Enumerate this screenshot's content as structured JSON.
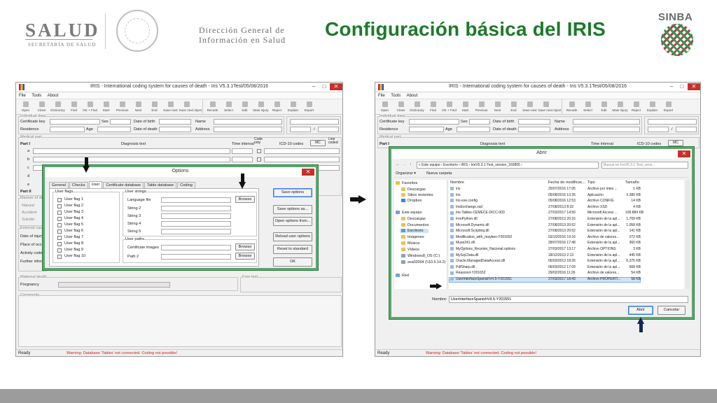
{
  "header": {
    "salud_word": "SALUD",
    "salud_sub": "SECRETARÍA DE SALUD",
    "dg_line1": "Dirección General de",
    "dg_line2": "Información en Salud",
    "slide_title": "Configuración básica del IRIS",
    "sinba": "SINBA"
  },
  "left_window": {
    "title": "IRIS - International coding system for causes of death - Iris V5.3.1Test/05/08/2016",
    "menu": [
      "File",
      "Tools",
      "About"
    ],
    "toolbar": [
      "Open",
      "Close",
      "Dictionary",
      "Find",
      "OK + Find",
      "Start",
      "Previous",
      "Next",
      "End",
      "Save next",
      "Save next reject",
      "Recode",
      "Select",
      "Edit",
      "Main injury",
      "Reject",
      "Explain",
      "Export"
    ],
    "groups": {
      "individual": "Individual data",
      "medical": "Medical part",
      "manner": "Manner of death",
      "external": "External cause",
      "maternal": "Maternal death",
      "freetext": "Free text",
      "comments": "Comments",
      "underlying": "Underlying cause of death"
    },
    "labels": {
      "cert_key": "Certificate key",
      "sex": "Sex",
      "dob": "Date of birth",
      "name": "Name",
      "residence": "Residence",
      "age": "Age",
      "dod": "Date of death",
      "address": "Address",
      "part1": "Part I",
      "part2": "Part II",
      "diag_text": "Diagnosis text",
      "time_interval": "Time interval",
      "code_only": "Code only",
      "icd10": "ICD-10 codes",
      "mc": "MC",
      "line_coded": "Line coded",
      "rows": [
        "a",
        "b",
        "c",
        "d",
        "e"
      ],
      "natural": "Natural",
      "accident": "Accident",
      "suicide": "Suicide",
      "date_of_injury": "Date of injury",
      "place_of_occur": "Place of occurr",
      "activity_code": "Activity code",
      "further_info": "Further inform",
      "pregnancy": "Pregnancy",
      "slash": "/"
    },
    "status_ready": "Ready",
    "status_warn": "Warning: Database 'Tables' not connected. Coding not possible!"
  },
  "options_dialog": {
    "title": "Options",
    "tabs": [
      "General",
      "Checks",
      "User",
      "Certificate database",
      "Table database",
      "Coding"
    ],
    "active_tab": "User",
    "user_flags_title": "User flags",
    "user_flags": [
      "User flag 1",
      "User flag 2",
      "User flag 3",
      "User flag 4",
      "User flag 5",
      "User flag 6",
      "User flag 7",
      "User flag 8",
      "User flag 9",
      "User flag 10"
    ],
    "user_strings_title": "User strings",
    "user_strings": [
      "Language file",
      "String 2",
      "String 3",
      "String 4",
      "String 5"
    ],
    "user_paths_title": "User paths",
    "user_paths": [
      "Certificate images",
      "Path 2"
    ],
    "browse": "Browse",
    "buttons": [
      "Save options",
      "Save options as...",
      "Open options from...",
      "Reload user options",
      "Reset to standard",
      "OK"
    ]
  },
  "right_window": {
    "title": "IRIS - International coding system for causes of death - Iris V5.3.1Test/05/08/2016",
    "status_ready": "Ready",
    "status_warn": "Warning: Database 'Tables' not connected. Coding not possible!"
  },
  "open_dialog": {
    "title": "Abrir",
    "breadcrumb": "« Este equipo › Escritorio › IRIS › IrisV5.3.1-Test_version_160805 ›",
    "search_placeholder": "Buscar en IrisV5.3.1-Test_versi...",
    "organize": "Organizar ▾",
    "new_folder": "Nueva carpeta",
    "col_name": "Nombre",
    "col_date": "Fecha de modificac...",
    "col_type": "Tipo",
    "col_size": "Tamaño",
    "nav": [
      "Favoritos",
      "Descargas",
      "Sitios recientes",
      "Dropbox",
      "Este equipo",
      "Descargas",
      "Documentos",
      "Escritorio",
      "Imágenes",
      "Música",
      "Vídeos",
      "Windows8_OS (C:)",
      "sea02004 (\\\\10.5.14.2)",
      "Red"
    ],
    "files": [
      {
        "name": "iris",
        "date": "25/07/2016 17:05",
        "type": "Archivo por lotes ...",
        "size": "1 KB"
      },
      {
        "name": "Iris",
        "date": "05/08/2016 13:26",
        "type": "Aplicación",
        "size": "3.380 KB"
      },
      {
        "name": "Iris.exe.config",
        "date": "05/08/2016 12:53",
        "type": "Archivo CONFIG",
        "size": "14 KB"
      },
      {
        "name": "IrisExchange.xsd",
        "date": "27/08/2013 8:32",
        "type": "Archivo XSD",
        "size": "4 KB"
      },
      {
        "name": "Iris-Tables-CEMECE-DICC-000",
        "date": "27/03/2017 14:50",
        "type": "Microsoft Access ...",
        "size": "109.884 KB"
      },
      {
        "name": "IronPython.dll",
        "date": "27/08/2013 20:16",
        "type": "Extensión de la apl...",
        "size": "1.769 KB"
      },
      {
        "name": "Microsoft.Dynamic.dll",
        "date": "27/08/2013 20:52",
        "type": "Extensión de la apl...",
        "size": "1.058 KB"
      },
      {
        "name": "Microsoft.Scripting.dll",
        "date": "27/08/2013 20:52",
        "type": "Extensión de la apl...",
        "size": "141 KB"
      },
      {
        "name": "Modification_with_maybes-Y201652",
        "date": "03/10/2016 19:16",
        "type": "Archivo de valores...",
        "size": "272 KB"
      },
      {
        "name": "Muse241.dll",
        "date": "28/07/2016 17:48",
        "type": "Extensión de la apl...",
        "size": "360 KB"
      },
      {
        "name": "MyOptions_Reunion_Nacional.options",
        "date": "27/03/2017 13:17",
        "type": "Archivo OPTIONS",
        "size": "3 KB"
      },
      {
        "name": "MySql.Data.dll",
        "date": "18/12/2013 2:13",
        "type": "Extensión de la apl...",
        "size": "445 KB"
      },
      {
        "name": "Oracle.ManagedDataAccess.dll",
        "date": "05/03/2013 18:26",
        "type": "Extensión de la apl...",
        "size": "6.375 KB"
      },
      {
        "name": "PdfSharp.dll",
        "date": "06/03/2012 17:09",
        "type": "Extensión de la apl...",
        "size": "568 KB"
      },
      {
        "name": "Reasonvl-Y201652",
        "date": "29/02/2016 11:26",
        "type": "Archivo de valores...",
        "size": "54 KB"
      },
      {
        "name": "UserInterfaceSpanishV4.5-Y201551",
        "date": "27/03/2017 18:43",
        "type": "Archivo PROPERTI...",
        "size": "58 KB"
      }
    ],
    "selected_index": 15,
    "filename_label": "Nombre:",
    "filename_value": "UserInterfaceSpanishV4.5-Y201551",
    "open_btn": "Abrir",
    "cancel_btn": "Cancelar"
  }
}
